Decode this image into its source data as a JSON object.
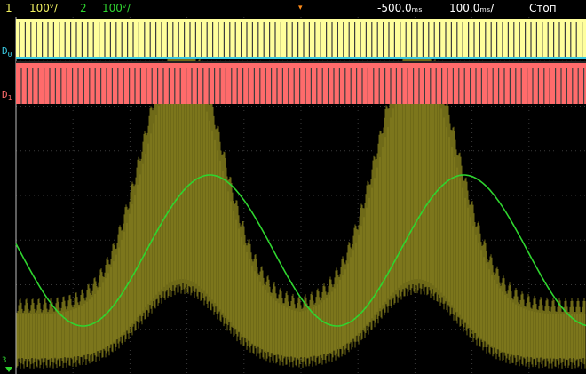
{
  "header": {
    "ch1_number": "1",
    "ch1_scale": "100ᵛ/",
    "ch2_number": "2",
    "ch2_scale": "100ᵛ/",
    "time_offset": "-500.0ₘₛ",
    "time_scale": "100.0ₘₛ/",
    "run_state": "Стоп"
  },
  "channel_labels": {
    "d0": "D",
    "d0_sub": "0",
    "d1": "D",
    "d1_sub": "1",
    "analog_marker": "3"
  },
  "colors": {
    "ch1": "#f0f060",
    "ch2": "#2fd42f",
    "d0_fill": "#ffff9c",
    "d1_fill": "#ff6b6b",
    "envelope": "#6f6a18",
    "grid": "#3a3a3a",
    "cyan": "#39c8e0"
  },
  "digital_lanes": {
    "d0": {
      "state": "toggling",
      "level": "high-dominant"
    },
    "d1": {
      "state": "toggling",
      "level": "high-dominant"
    }
  }
}
